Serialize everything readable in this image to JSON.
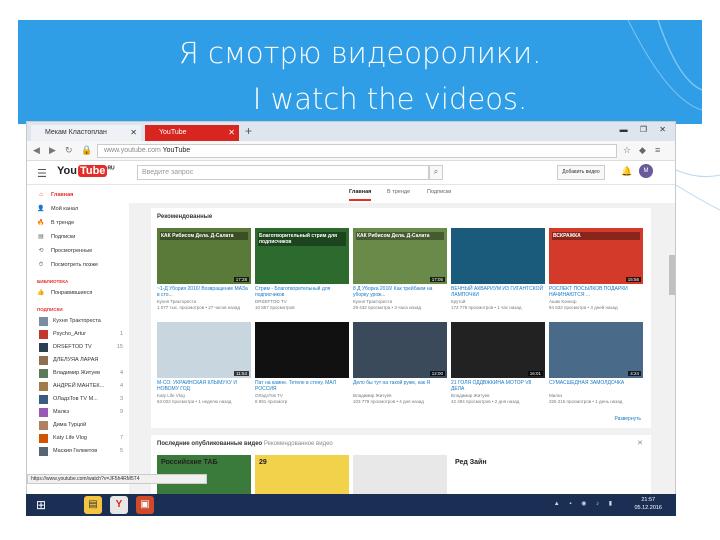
{
  "slide_title_ru": "Я смотрю  видеоролики.",
  "slide_title_en": "I watch the videos.",
  "browser": {
    "tab1": "Мекам Кластоплан",
    "tab2": "YouTube",
    "new_tab": "+",
    "url_prefix": "www.youtube.com",
    "url_page": "YouTube",
    "window_controls": "▬ ❐ ✕"
  },
  "youtube": {
    "logo": "You",
    "logo_tube": "Tube",
    "logo_suffix": "RU",
    "search_placeholder": "Введите запрос",
    "add_video": "Добавить видео",
    "avatar": "М",
    "tabs": [
      "Главная",
      "В тренде",
      "Подписки"
    ],
    "sidebar": [
      "Главная",
      "Мой канал",
      "В тренде",
      "Подписки",
      "Просмотренные",
      "Посмотреть позже"
    ],
    "library_heading": "БИБЛИОТЕКА",
    "library": [
      "Понравившиеся"
    ],
    "subs_heading": "ПОДПИСКИ",
    "subs": [
      {
        "name": "Кухня Трактореста",
        "count": ""
      },
      {
        "name": "Psycho_Artur",
        "count": "1"
      },
      {
        "name": "DRSEFTOD TV",
        "count": "15"
      },
      {
        "name": "ДЛЕЛУЯА ЛАРАЯ",
        "count": ""
      },
      {
        "name": "Владимир Житуев",
        "count": "4"
      },
      {
        "name": "АНДРЕЙ МАНТЕК...",
        "count": "4"
      },
      {
        "name": "ОЛадзТов ТV М...",
        "count": "3"
      },
      {
        "name": "Малкэ",
        "count": "9"
      },
      {
        "name": "Дима Турцой",
        "count": ""
      },
      {
        "name": "Katy Life Vlog",
        "count": "7"
      },
      {
        "name": "Маския Гелметов",
        "count": "5"
      }
    ],
    "recommended_heading": "Рекомендованные",
    "videos": [
      {
        "title": "~1-Д Убория 2016! Возвращение МАЗа в сто...",
        "channel": "Кухня Трактореста",
        "stats": "1 077 тыс. просмотров • 27 часов назад",
        "dur": "17:28",
        "thumb_text": "КАК Рибисом Дела. Д-Салата"
      },
      {
        "title": "Стрим - Благотворительный для подписчиков",
        "channel": "DRSEFTOD TV",
        "stats": "10 857 просмотров",
        "dur": "",
        "thumb_text": "Благотворительный стрим для подписчиков"
      },
      {
        "title": "8 Д Уборка 2016! Как трейбаем на уборку урож...",
        "channel": "Кухня Трактореста",
        "stats": "29 432 просмотра • 3 часа назад",
        "dur": "17:05",
        "thumb_text": "КАК Рибисом Дела. Д-Салата"
      },
      {
        "title": "ВЕЧНЫЙ АКВАРИУМ ИЗ ГИГАНТСКОЙ ЛАМПОЧКИ",
        "channel": "Крутой",
        "stats": "172 778 просмотров • 1 час назад",
        "dur": "",
        "thumb_text": ""
      },
      {
        "title": "РОСЛЕКТ ПОСЫЛКОВ ПОДАРКИ НАЧИНАЮТСЯ ...",
        "channel": "Ашик Коннор",
        "stats": "94 532 просмотра • 3 дней назад",
        "dur": "15:56",
        "thumb_text": "ВСКРАЖКА"
      },
      {
        "title": "М-СО: УКРАИНСКАЯ КЛЫМУХУ И НОВОМУ ГОД",
        "channel": "Katy Life Vlog",
        "stats": "63 022 просмотра • 1 неделю назад",
        "dur": "11:54",
        "thumb_text": ""
      },
      {
        "title": "Пат на камне. Тетеле в стену. МАЛ РОССИЯ",
        "channel": "ОЛадзТов ТV",
        "stats": "8 891 просмотр",
        "dur": "",
        "thumb_text": ""
      },
      {
        "title": "Дело бы тут на такой руже, как Я",
        "channel": "Владимир Житуев",
        "stats": "103 779 просмотров • 4 дня назад",
        "dur": "12:00",
        "thumb_text": ""
      },
      {
        "title": "21 ГОЛЯ ОДДВЖКИНА МОТОР V8 ДЕЛА",
        "channel": "Владимир Житуев",
        "stats": "42 494 просмотров • 2 дня назад",
        "dur": "16:01",
        "thumb_text": ""
      },
      {
        "title": "СУМАСШЕДНАЯ ЗАМОЛДОЧКА",
        "channel": "Малкэ",
        "stats": "326 215 просмотров • 1 день назад",
        "dur": "4:24",
        "thumb_text": ""
      }
    ],
    "expand": "Развернуть",
    "latest_heading": "Последние опубликованные видео",
    "latest_sub": "Рекомендованное видео",
    "latest_thumbs": [
      "Российские ТАБ",
      "29",
      "",
      "Ред Зайн"
    ],
    "status_url": "https://www.youtube.com/watch?v=JF5h4RM5T4"
  },
  "taskbar": {
    "time": "21:57",
    "date": "05.12.2016"
  }
}
